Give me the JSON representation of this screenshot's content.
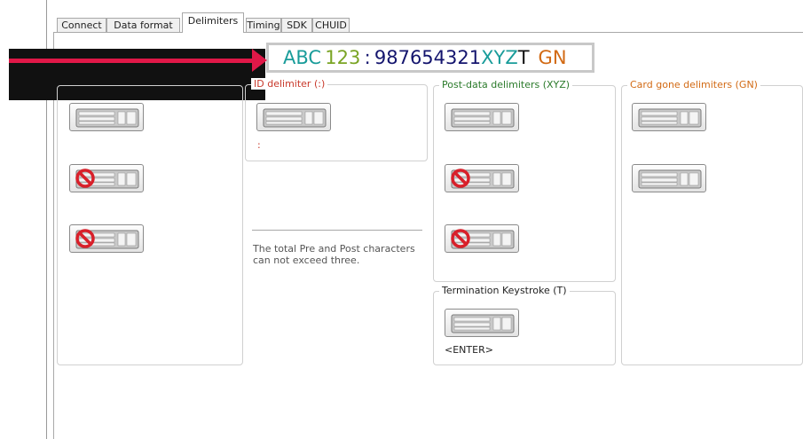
{
  "tabs": [
    {
      "label": "Connect"
    },
    {
      "label": "Data format"
    },
    {
      "label": "Delimiters",
      "active": true
    },
    {
      "label": "Timing"
    },
    {
      "label": "SDK"
    },
    {
      "label": "CHUID"
    }
  ],
  "banner": {
    "pre": "ABC",
    "num1": "123",
    "colon": ":",
    "num2": "987654321",
    "post": "XYZ",
    "term": "T",
    "gone": "GN"
  },
  "groups": {
    "id_delimiter": {
      "title": "ID delimiter (:)",
      "value": ":"
    },
    "post_data": {
      "title": "Post-data delimiters (XYZ)"
    },
    "card_gone": {
      "title": "Card gone delimiters (GN)"
    },
    "termination": {
      "title": "Termination Keystroke (T)",
      "value": "<ENTER>"
    }
  },
  "note": "The total Pre and Post characters can not exceed three.",
  "icons": {
    "keyboard": "keyboard-icon",
    "disabled": "no-entry-icon"
  },
  "colors": {
    "arrow": "#e01848",
    "banner_teal": "#199c9a",
    "banner_green": "#7aa424",
    "banner_navy": "#14156e",
    "banner_orange": "#d26a14"
  }
}
